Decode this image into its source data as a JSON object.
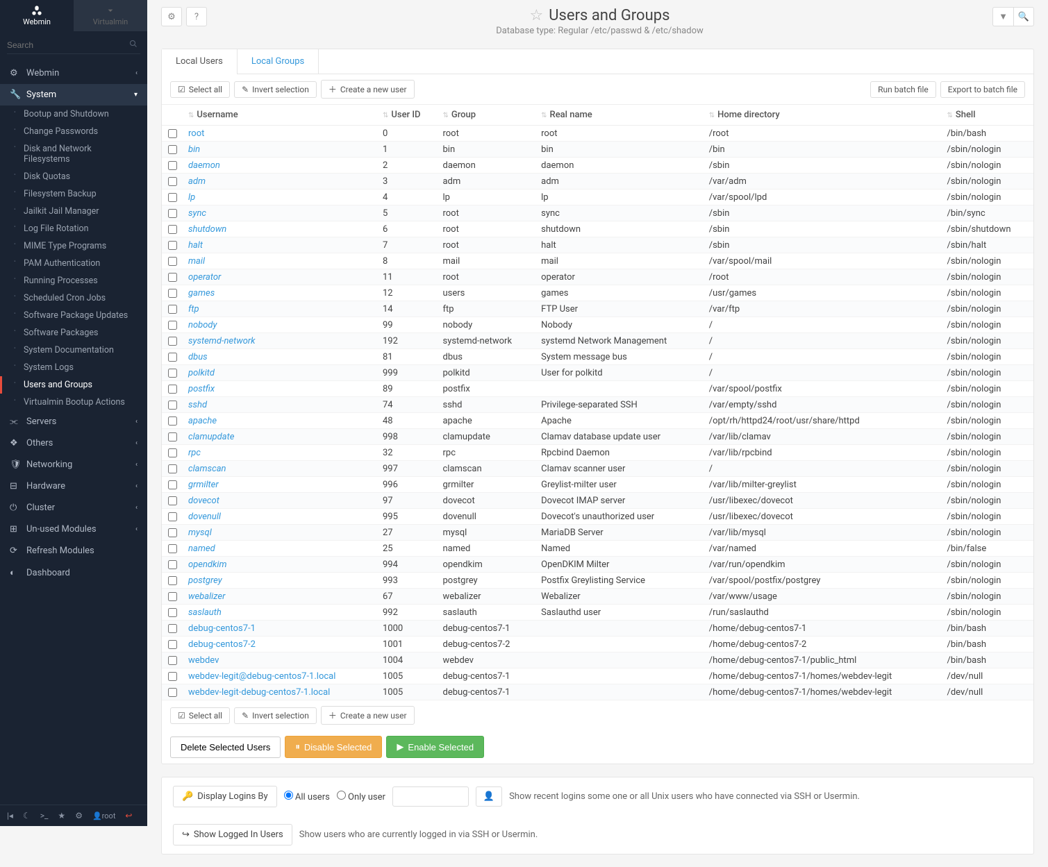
{
  "brand": {
    "webmin": "Webmin",
    "virtualmin": "Virtualmin"
  },
  "search": {
    "placeholder": "Search"
  },
  "nav": {
    "webmin": "Webmin",
    "system": "System",
    "system_items": [
      "Bootup and Shutdown",
      "Change Passwords",
      "Disk and Network Filesystems",
      "Disk Quotas",
      "Filesystem Backup",
      "Jailkit Jail Manager",
      "Log File Rotation",
      "MIME Type Programs",
      "PAM Authentication",
      "Running Processes",
      "Scheduled Cron Jobs",
      "Software Package Updates",
      "Software Packages",
      "System Documentation",
      "System Logs",
      "Users and Groups",
      "Virtualmin Bootup Actions"
    ],
    "servers": "Servers",
    "others": "Others",
    "networking": "Networking",
    "hardware": "Hardware",
    "cluster": "Cluster",
    "unused": "Un-used Modules",
    "refresh": "Refresh Modules",
    "dashboard": "Dashboard"
  },
  "footer_user": "root",
  "header": {
    "title": "Users and Groups",
    "subtitle": "Database type: Regular /etc/passwd & /etc/shadow"
  },
  "tabs": {
    "local_users": "Local Users",
    "local_groups": "Local Groups"
  },
  "toolbar": {
    "select_all": "Select all",
    "invert": "Invert selection",
    "create": "Create a new user",
    "run_batch": "Run batch file",
    "export_batch": "Export to batch file"
  },
  "columns": [
    "Username",
    "User ID",
    "Group",
    "Real name",
    "Home directory",
    "Shell"
  ],
  "users": [
    {
      "u": "root",
      "id": "0",
      "g": "root",
      "r": "root",
      "h": "/root",
      "s": "/bin/bash",
      "it": false
    },
    {
      "u": "bin",
      "id": "1",
      "g": "bin",
      "r": "bin",
      "h": "/bin",
      "s": "/sbin/nologin",
      "it": true
    },
    {
      "u": "daemon",
      "id": "2",
      "g": "daemon",
      "r": "daemon",
      "h": "/sbin",
      "s": "/sbin/nologin",
      "it": true
    },
    {
      "u": "adm",
      "id": "3",
      "g": "adm",
      "r": "adm",
      "h": "/var/adm",
      "s": "/sbin/nologin",
      "it": true
    },
    {
      "u": "lp",
      "id": "4",
      "g": "lp",
      "r": "lp",
      "h": "/var/spool/lpd",
      "s": "/sbin/nologin",
      "it": true
    },
    {
      "u": "sync",
      "id": "5",
      "g": "root",
      "r": "sync",
      "h": "/sbin",
      "s": "/bin/sync",
      "it": true
    },
    {
      "u": "shutdown",
      "id": "6",
      "g": "root",
      "r": "shutdown",
      "h": "/sbin",
      "s": "/sbin/shutdown",
      "it": true
    },
    {
      "u": "halt",
      "id": "7",
      "g": "root",
      "r": "halt",
      "h": "/sbin",
      "s": "/sbin/halt",
      "it": true
    },
    {
      "u": "mail",
      "id": "8",
      "g": "mail",
      "r": "mail",
      "h": "/var/spool/mail",
      "s": "/sbin/nologin",
      "it": true
    },
    {
      "u": "operator",
      "id": "11",
      "g": "root",
      "r": "operator",
      "h": "/root",
      "s": "/sbin/nologin",
      "it": true
    },
    {
      "u": "games",
      "id": "12",
      "g": "users",
      "r": "games",
      "h": "/usr/games",
      "s": "/sbin/nologin",
      "it": true
    },
    {
      "u": "ftp",
      "id": "14",
      "g": "ftp",
      "r": "FTP User",
      "h": "/var/ftp",
      "s": "/sbin/nologin",
      "it": true
    },
    {
      "u": "nobody",
      "id": "99",
      "g": "nobody",
      "r": "Nobody",
      "h": "/",
      "s": "/sbin/nologin",
      "it": true
    },
    {
      "u": "systemd-network",
      "id": "192",
      "g": "systemd-network",
      "r": "systemd Network Management",
      "h": "/",
      "s": "/sbin/nologin",
      "it": true
    },
    {
      "u": "dbus",
      "id": "81",
      "g": "dbus",
      "r": "System message bus",
      "h": "/",
      "s": "/sbin/nologin",
      "it": true
    },
    {
      "u": "polkitd",
      "id": "999",
      "g": "polkitd",
      "r": "User for polkitd",
      "h": "/",
      "s": "/sbin/nologin",
      "it": true
    },
    {
      "u": "postfix",
      "id": "89",
      "g": "postfix",
      "r": "",
      "h": "/var/spool/postfix",
      "s": "/sbin/nologin",
      "it": true
    },
    {
      "u": "sshd",
      "id": "74",
      "g": "sshd",
      "r": "Privilege-separated SSH",
      "h": "/var/empty/sshd",
      "s": "/sbin/nologin",
      "it": true
    },
    {
      "u": "apache",
      "id": "48",
      "g": "apache",
      "r": "Apache",
      "h": "/opt/rh/httpd24/root/usr/share/httpd",
      "s": "/sbin/nologin",
      "it": true
    },
    {
      "u": "clamupdate",
      "id": "998",
      "g": "clamupdate",
      "r": "Clamav database update user",
      "h": "/var/lib/clamav",
      "s": "/sbin/nologin",
      "it": true
    },
    {
      "u": "rpc",
      "id": "32",
      "g": "rpc",
      "r": "Rpcbind Daemon",
      "h": "/var/lib/rpcbind",
      "s": "/sbin/nologin",
      "it": true
    },
    {
      "u": "clamscan",
      "id": "997",
      "g": "clamscan",
      "r": "Clamav scanner user",
      "h": "/",
      "s": "/sbin/nologin",
      "it": true
    },
    {
      "u": "grmilter",
      "id": "996",
      "g": "grmilter",
      "r": "Greylist-milter user",
      "h": "/var/lib/milter-greylist",
      "s": "/sbin/nologin",
      "it": true
    },
    {
      "u": "dovecot",
      "id": "97",
      "g": "dovecot",
      "r": "Dovecot IMAP server",
      "h": "/usr/libexec/dovecot",
      "s": "/sbin/nologin",
      "it": true
    },
    {
      "u": "dovenull",
      "id": "995",
      "g": "dovenull",
      "r": "Dovecot's unauthorized user",
      "h": "/usr/libexec/dovecot",
      "s": "/sbin/nologin",
      "it": true
    },
    {
      "u": "mysql",
      "id": "27",
      "g": "mysql",
      "r": "MariaDB Server",
      "h": "/var/lib/mysql",
      "s": "/sbin/nologin",
      "it": true
    },
    {
      "u": "named",
      "id": "25",
      "g": "named",
      "r": "Named",
      "h": "/var/named",
      "s": "/bin/false",
      "it": true
    },
    {
      "u": "opendkim",
      "id": "994",
      "g": "opendkim",
      "r": "OpenDKIM Milter",
      "h": "/var/run/opendkim",
      "s": "/sbin/nologin",
      "it": true
    },
    {
      "u": "postgrey",
      "id": "993",
      "g": "postgrey",
      "r": "Postfix Greylisting Service",
      "h": "/var/spool/postfix/postgrey",
      "s": "/sbin/nologin",
      "it": true
    },
    {
      "u": "webalizer",
      "id": "67",
      "g": "webalizer",
      "r": "Webalizer",
      "h": "/var/www/usage",
      "s": "/sbin/nologin",
      "it": true
    },
    {
      "u": "saslauth",
      "id": "992",
      "g": "saslauth",
      "r": "Saslauthd user",
      "h": "/run/saslauthd",
      "s": "/sbin/nologin",
      "it": true
    },
    {
      "u": "debug-centos7-1",
      "id": "1000",
      "g": "debug-centos7-1",
      "r": "",
      "h": "/home/debug-centos7-1",
      "s": "/bin/bash",
      "it": false
    },
    {
      "u": "debug-centos7-2",
      "id": "1001",
      "g": "debug-centos7-2",
      "r": "",
      "h": "/home/debug-centos7-2",
      "s": "/bin/bash",
      "it": false
    },
    {
      "u": "webdev",
      "id": "1004",
      "g": "webdev",
      "r": "",
      "h": "/home/debug-centos7-1/public_html",
      "s": "/bin/bash",
      "it": false
    },
    {
      "u": "webdev-legit@debug-centos7-1.local",
      "id": "1005",
      "g": "debug-centos7-1",
      "r": "",
      "h": "/home/debug-centos7-1/homes/webdev-legit",
      "s": "/dev/null",
      "it": false
    },
    {
      "u": "webdev-legit-debug-centos7-1.local",
      "id": "1005",
      "g": "debug-centos7-1",
      "r": "",
      "h": "/home/debug-centos7-1/homes/webdev-legit",
      "s": "/dev/null",
      "it": false
    }
  ],
  "actions": {
    "delete": "Delete Selected Users",
    "disable": "Disable Selected",
    "enable": "Enable Selected"
  },
  "logins": {
    "display_by": "Display Logins By",
    "all_users": "All users",
    "only_user": "Only user",
    "desc1": "Show recent logins some one or all Unix users who have connected via SSH or Usermin.",
    "show_logged": "Show Logged In Users",
    "desc2": "Show users who are currently logged in via SSH or Usermin."
  }
}
